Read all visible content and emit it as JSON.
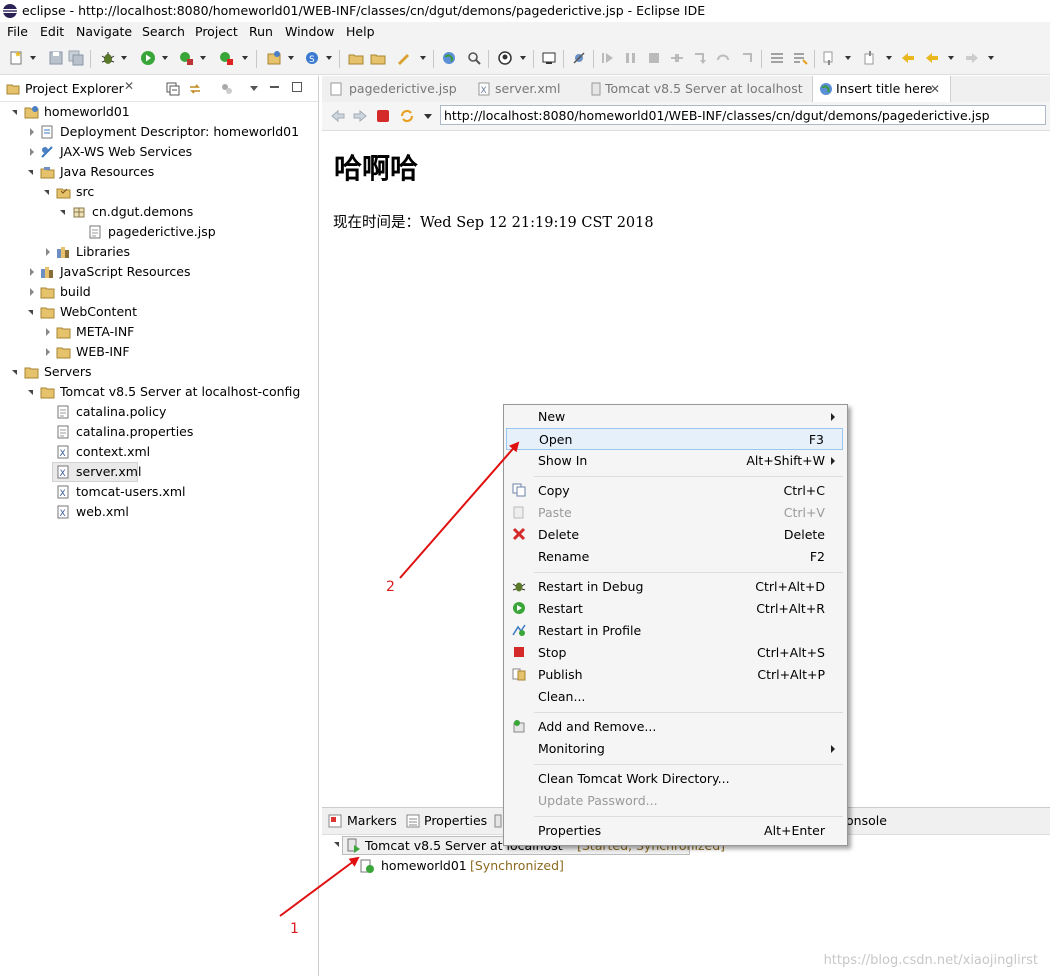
{
  "window": {
    "title": "eclipse - http://localhost:8080/homeworld01/WEB-INF/classes/cn/dgut/demons/pagederictive.jsp - Eclipse IDE"
  },
  "menu": [
    "File",
    "Edit",
    "Navigate",
    "Search",
    "Project",
    "Run",
    "Window",
    "Help"
  ],
  "explorer": {
    "title": "Project Explorer",
    "items": [
      {
        "label": "homeworld01"
      },
      {
        "label": "Deployment Descriptor: homeworld01"
      },
      {
        "label": "JAX-WS Web Services"
      },
      {
        "label": "Java Resources"
      },
      {
        "label": "src"
      },
      {
        "label": "cn.dgut.demons"
      },
      {
        "label": "pagederictive.jsp"
      },
      {
        "label": "Libraries"
      },
      {
        "label": "JavaScript Resources"
      },
      {
        "label": "build"
      },
      {
        "label": "WebContent"
      },
      {
        "label": "META-INF"
      },
      {
        "label": "WEB-INF"
      },
      {
        "label": "Servers"
      },
      {
        "label": "Tomcat v8.5 Server at localhost-config"
      },
      {
        "label": "catalina.policy"
      },
      {
        "label": "catalina.properties"
      },
      {
        "label": "context.xml"
      },
      {
        "label": "server.xml"
      },
      {
        "label": "tomcat-users.xml"
      },
      {
        "label": "web.xml"
      }
    ]
  },
  "editor": {
    "tabs": [
      {
        "label": "pagederictive.jsp"
      },
      {
        "label": "server.xml"
      },
      {
        "label": "Tomcat v8.5 Server at localhost"
      },
      {
        "label": "Insert title here"
      }
    ],
    "url": "http://localhost:8080/homeworld01/WEB-INF/classes/cn/dgut/demons/pagederictive.jsp",
    "page_heading": "哈啊哈",
    "page_text": "现在时间是：Wed Sep 12 21:19:19 CST 2018"
  },
  "bottom": {
    "tabs": [
      {
        "label": "Markers"
      },
      {
        "label": "Properties"
      },
      {
        "label": "onsole"
      }
    ],
    "server_label": "Tomcat v8.5 Server at localhost",
    "server_status": "[Started, Synchronized]",
    "module_label": "homeworld01",
    "module_status": "[Synchronized]"
  },
  "context_menu": {
    "items": [
      {
        "label": "New",
        "shortcut": ""
      },
      {
        "label": "Open",
        "shortcut": "F3"
      },
      {
        "label": "Show In",
        "shortcut": "Alt+Shift+W"
      },
      {
        "label": "Copy",
        "shortcut": "Ctrl+C"
      },
      {
        "label": "Paste",
        "shortcut": "Ctrl+V"
      },
      {
        "label": "Delete",
        "shortcut": "Delete"
      },
      {
        "label": "Rename",
        "shortcut": "F2"
      },
      {
        "label": "Restart in Debug",
        "shortcut": "Ctrl+Alt+D"
      },
      {
        "label": "Restart",
        "shortcut": "Ctrl+Alt+R"
      },
      {
        "label": "Restart in Profile",
        "shortcut": ""
      },
      {
        "label": "Stop",
        "shortcut": "Ctrl+Alt+S"
      },
      {
        "label": "Publish",
        "shortcut": "Ctrl+Alt+P"
      },
      {
        "label": "Clean...",
        "shortcut": ""
      },
      {
        "label": "Add and Remove...",
        "shortcut": ""
      },
      {
        "label": "Monitoring",
        "shortcut": ""
      },
      {
        "label": "Clean Tomcat Work Directory...",
        "shortcut": ""
      },
      {
        "label": "Update Password...",
        "shortcut": ""
      },
      {
        "label": "Properties",
        "shortcut": "Alt+Enter"
      }
    ]
  },
  "annotations": [
    "1",
    "2"
  ],
  "watermark": "https://blog.csdn.net/xiaojinglirst",
  "colors": {
    "annotation": "#d91c1c",
    "highlight": "#e5f0fb",
    "selection": "#cce8ff"
  }
}
